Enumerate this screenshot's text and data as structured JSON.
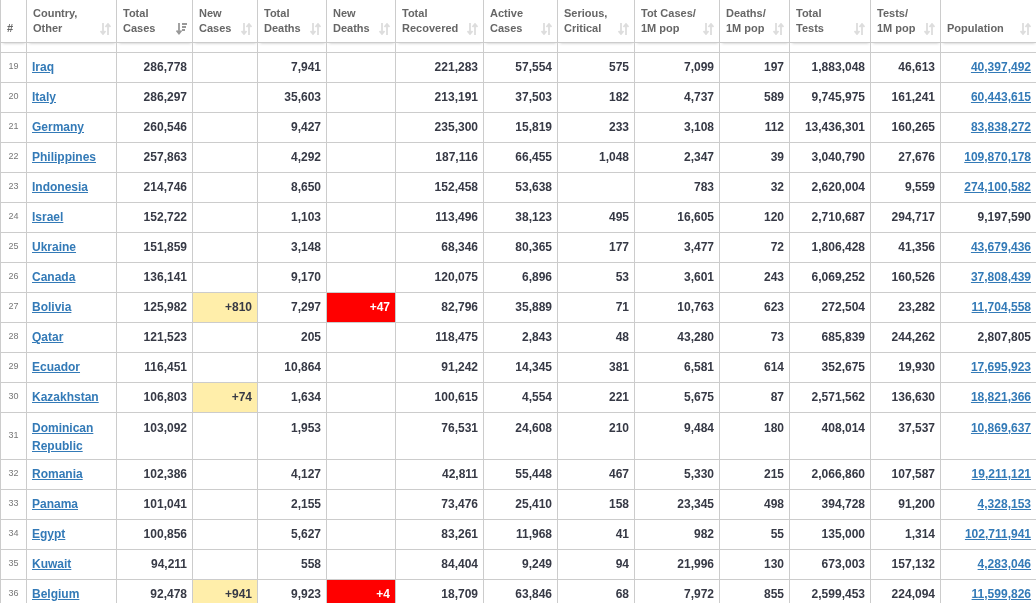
{
  "table": {
    "columns": [
      {
        "label": "#",
        "sortable": false,
        "sorted": false
      },
      {
        "label": "Country,\nOther",
        "sortable": true,
        "sorted": false
      },
      {
        "label": "Total\nCases",
        "sortable": true,
        "sorted": true
      },
      {
        "label": "New\nCases",
        "sortable": true,
        "sorted": false
      },
      {
        "label": "Total\nDeaths",
        "sortable": true,
        "sorted": false
      },
      {
        "label": "New\nDeaths",
        "sortable": true,
        "sorted": false
      },
      {
        "label": "Total\nRecovered",
        "sortable": true,
        "sorted": false
      },
      {
        "label": "Active\nCases",
        "sortable": true,
        "sorted": false
      },
      {
        "label": "Serious,\nCritical",
        "sortable": true,
        "sorted": false
      },
      {
        "label": "Tot Cases/\n1M pop",
        "sortable": true,
        "sorted": false
      },
      {
        "label": "Deaths/\n1M pop",
        "sortable": true,
        "sorted": false
      },
      {
        "label": "Total\nTests",
        "sortable": true,
        "sorted": false
      },
      {
        "label": "Tests/\n1M pop",
        "sortable": true,
        "sorted": false
      },
      {
        "label": "Population",
        "sortable": true,
        "sorted": false
      }
    ],
    "rows": [
      {
        "cells": [
          "19",
          "Iraq",
          "286,778",
          "",
          "7,941",
          "",
          "221,283",
          "57,554",
          "575",
          "7,099",
          "197",
          "1,883,048",
          "46,613",
          "40,397,492"
        ],
        "population_linked": true
      },
      {
        "cells": [
          "20",
          "Italy",
          "286,297",
          "",
          "35,603",
          "",
          "213,191",
          "37,503",
          "182",
          "4,737",
          "589",
          "9,745,975",
          "161,241",
          "60,443,615"
        ],
        "population_linked": true
      },
      {
        "cells": [
          "21",
          "Germany",
          "260,546",
          "",
          "9,427",
          "",
          "235,300",
          "15,819",
          "233",
          "3,108",
          "112",
          "13,436,301",
          "160,265",
          "83,838,272"
        ],
        "population_linked": true
      },
      {
        "cells": [
          "22",
          "Philippines",
          "257,863",
          "",
          "4,292",
          "",
          "187,116",
          "66,455",
          "1,048",
          "2,347",
          "39",
          "3,040,790",
          "27,676",
          "109,870,178"
        ],
        "population_linked": true
      },
      {
        "cells": [
          "23",
          "Indonesia",
          "214,746",
          "",
          "8,650",
          "",
          "152,458",
          "53,638",
          "",
          "783",
          "32",
          "2,620,004",
          "9,559",
          "274,100,582"
        ],
        "population_linked": true
      },
      {
        "cells": [
          "24",
          "Israel",
          "152,722",
          "",
          "1,103",
          "",
          "113,496",
          "38,123",
          "495",
          "16,605",
          "120",
          "2,710,687",
          "294,717",
          "9,197,590"
        ],
        "population_linked": false
      },
      {
        "cells": [
          "25",
          "Ukraine",
          "151,859",
          "",
          "3,148",
          "",
          "68,346",
          "80,365",
          "177",
          "3,477",
          "72",
          "1,806,428",
          "41,356",
          "43,679,436"
        ],
        "population_linked": true
      },
      {
        "cells": [
          "26",
          "Canada",
          "136,141",
          "",
          "9,170",
          "",
          "120,075",
          "6,896",
          "53",
          "3,601",
          "243",
          "6,069,252",
          "160,526",
          "37,808,439"
        ],
        "population_linked": true
      },
      {
        "cells": [
          "27",
          "Bolivia",
          "125,982",
          "+810",
          "7,297",
          "+47",
          "82,796",
          "35,889",
          "71",
          "10,763",
          "623",
          "272,504",
          "23,282",
          "11,704,558"
        ],
        "population_linked": true
      },
      {
        "cells": [
          "28",
          "Qatar",
          "121,523",
          "",
          "205",
          "",
          "118,475",
          "2,843",
          "48",
          "43,280",
          "73",
          "685,839",
          "244,262",
          "2,807,805"
        ],
        "population_linked": false
      },
      {
        "cells": [
          "29",
          "Ecuador",
          "116,451",
          "",
          "10,864",
          "",
          "91,242",
          "14,345",
          "381",
          "6,581",
          "614",
          "352,675",
          "19,930",
          "17,695,923"
        ],
        "population_linked": true
      },
      {
        "cells": [
          "30",
          "Kazakhstan",
          "106,803",
          "+74",
          "1,634",
          "",
          "100,615",
          "4,554",
          "221",
          "5,675",
          "87",
          "2,571,562",
          "136,630",
          "18,821,366"
        ],
        "population_linked": true
      },
      {
        "cells": [
          "31",
          "Dominican Republic",
          "103,092",
          "",
          "1,953",
          "",
          "76,531",
          "24,608",
          "210",
          "9,484",
          "180",
          "408,014",
          "37,537",
          "10,869,637"
        ],
        "population_linked": true
      },
      {
        "cells": [
          "32",
          "Romania",
          "102,386",
          "",
          "4,127",
          "",
          "42,811",
          "55,448",
          "467",
          "5,330",
          "215",
          "2,066,860",
          "107,587",
          "19,211,121"
        ],
        "population_linked": true
      },
      {
        "cells": [
          "33",
          "Panama",
          "101,041",
          "",
          "2,155",
          "",
          "73,476",
          "25,410",
          "158",
          "23,345",
          "498",
          "394,728",
          "91,200",
          "4,328,153"
        ],
        "population_linked": true
      },
      {
        "cells": [
          "34",
          "Egypt",
          "100,856",
          "",
          "5,627",
          "",
          "83,261",
          "11,968",
          "41",
          "982",
          "55",
          "135,000",
          "1,314",
          "102,711,941"
        ],
        "population_linked": true
      },
      {
        "cells": [
          "35",
          "Kuwait",
          "94,211",
          "",
          "558",
          "",
          "84,404",
          "9,249",
          "94",
          "21,996",
          "130",
          "673,003",
          "157,132",
          "4,283,046"
        ],
        "population_linked": true
      },
      {
        "cells": [
          "36",
          "Belgium",
          "92,478",
          "+941",
          "9,923",
          "+4",
          "18,709",
          "63,846",
          "68",
          "7,972",
          "855",
          "2,599,453",
          "224,094",
          "11,599,826"
        ],
        "population_linked": true
      }
    ]
  }
}
